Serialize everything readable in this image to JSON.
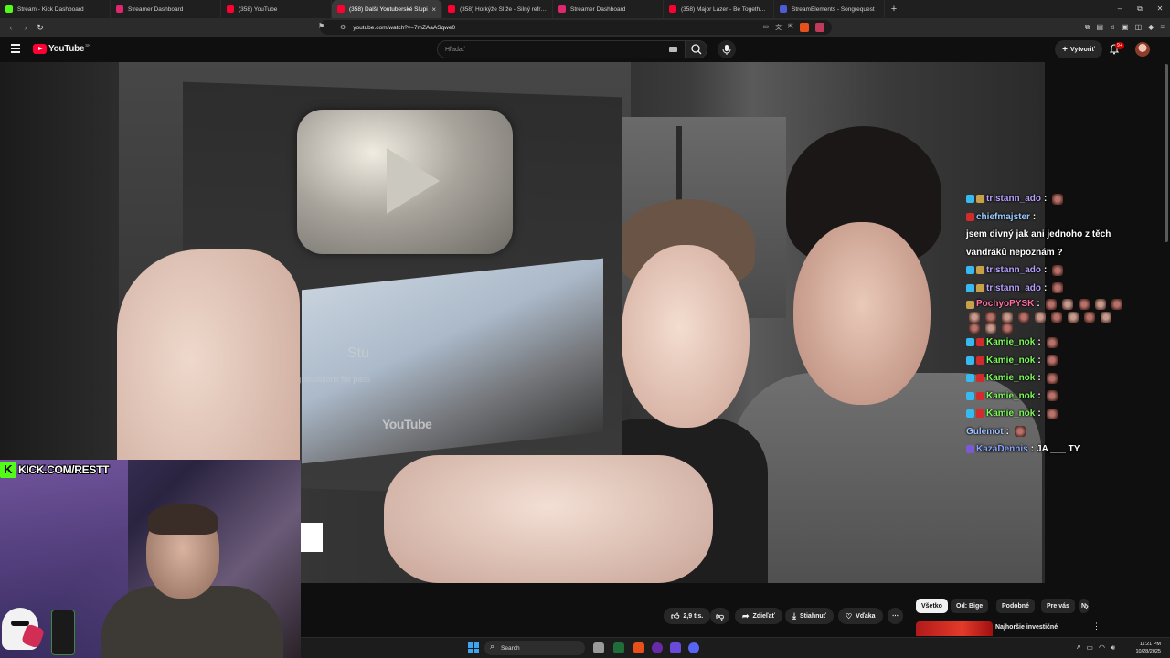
{
  "browser": {
    "tabs": [
      {
        "label": "Stream - Kick Dashboard",
        "color": "#53fc18"
      },
      {
        "label": "Streamer Dashboard",
        "color": "#e0266f"
      },
      {
        "label": "(358) YouTube",
        "color": "#ff0033"
      },
      {
        "label": "(358) Další Youtuberské Slupi",
        "color": "#ff0033",
        "active": true
      },
      {
        "label": "(358) Horkýže Slíže - Silný refrén [ofi",
        "color": "#ff0033"
      },
      {
        "label": "Streamer Dashboard",
        "color": "#e0266f"
      },
      {
        "label": "(358) Major Lazer - Be Together (fea",
        "color": "#ff0033"
      },
      {
        "label": "StreamElements - Songrequest",
        "color": "#4f5bd5"
      }
    ],
    "new_tab": "+",
    "url": "youtube.com/watch?v=7mZAaASqwe0",
    "window_controls": [
      "–",
      "⧉",
      "✕"
    ]
  },
  "youtube": {
    "logo_text": "YouTube",
    "country": "SK",
    "search_placeholder": "Hľadať",
    "create_label": "Vytvoriť",
    "notif_badge": "9+"
  },
  "video": {
    "plaque_text": "Stu",
    "plaque_subtext": "Congratulations for pass",
    "plaque_logo": "YouTube"
  },
  "chat": [
    {
      "user": "tristann_ado",
      "color": "#b7a0ff",
      "badges": [
        "#37b9f2",
        "#c8a04a"
      ],
      "text": "",
      "emotes": 1
    },
    {
      "user": "chiefmajster",
      "color": "#99ccff",
      "badges": [
        "#d22b2b"
      ],
      "text": "jsem divný jak ani jednoho z těch vandráků nepoznám ?",
      "emotes": 0
    },
    {
      "user": "tristann_ado",
      "color": "#b7a0ff",
      "badges": [
        "#37b9f2",
        "#c8a04a"
      ],
      "text": "",
      "emotes": 1
    },
    {
      "user": "tristann_ado",
      "color": "#b7a0ff",
      "badges": [
        "#37b9f2",
        "#c8a04a"
      ],
      "text": "",
      "emotes": 1
    },
    {
      "user": "PochyoPYSK",
      "color": "#ff6fa0",
      "badges": [
        "#c8a04a"
      ],
      "text": "",
      "emotes": 17
    },
    {
      "user": "Kamie_nok",
      "color": "#7dfc5a",
      "badges": [
        "#37b9f2",
        "#d22b2b"
      ],
      "text": "",
      "emotes": 1
    },
    {
      "user": "Kamie_nok",
      "color": "#7dfc5a",
      "badges": [
        "#37b9f2",
        "#d22b2b"
      ],
      "text": "",
      "emotes": 1
    },
    {
      "user": "Kamie_nok",
      "color": "#7dfc5a",
      "badges": [
        "#37b9f2",
        "#d22b2b"
      ],
      "text": "",
      "emotes": 1
    },
    {
      "user": "Kamie_nok",
      "color": "#7dfc5a",
      "badges": [
        "#37b9f2",
        "#d22b2b"
      ],
      "text": "",
      "emotes": 1
    },
    {
      "user": "Kamie_nok",
      "color": "#7dfc5a",
      "badges": [
        "#37b9f2",
        "#d22b2b"
      ],
      "text": "",
      "emotes": 1
    },
    {
      "user": "Gulemot",
      "color": "#a0c0ff",
      "badges": [],
      "text": "",
      "emotes": 1
    },
    {
      "user": "KazaDennis",
      "color": "#8aa4ff",
      "badges": [
        "#7a5ad2"
      ],
      "text": "JA ___ TY",
      "emotes": 0
    }
  ],
  "overlay": {
    "kick_logo": "K",
    "kick_text": "KICK.COM/RESTT"
  },
  "actions": {
    "like_count": "2,9 tis.",
    "share_label": "Zdieľať",
    "download_label": "Stiahnuť",
    "thanks_label": "Vďaka",
    "more": "⋯"
  },
  "filters": [
    "Všetko",
    "Od: Bige",
    "Podobné",
    "Pre vás",
    "N"
  ],
  "recommendation": {
    "title": "Najhoršie investičné rozhodnutia, o...@Duklock"
  },
  "taskbar": {
    "search": "Search",
    "time": "11:21 PM",
    "date": "10/28/2025"
  }
}
